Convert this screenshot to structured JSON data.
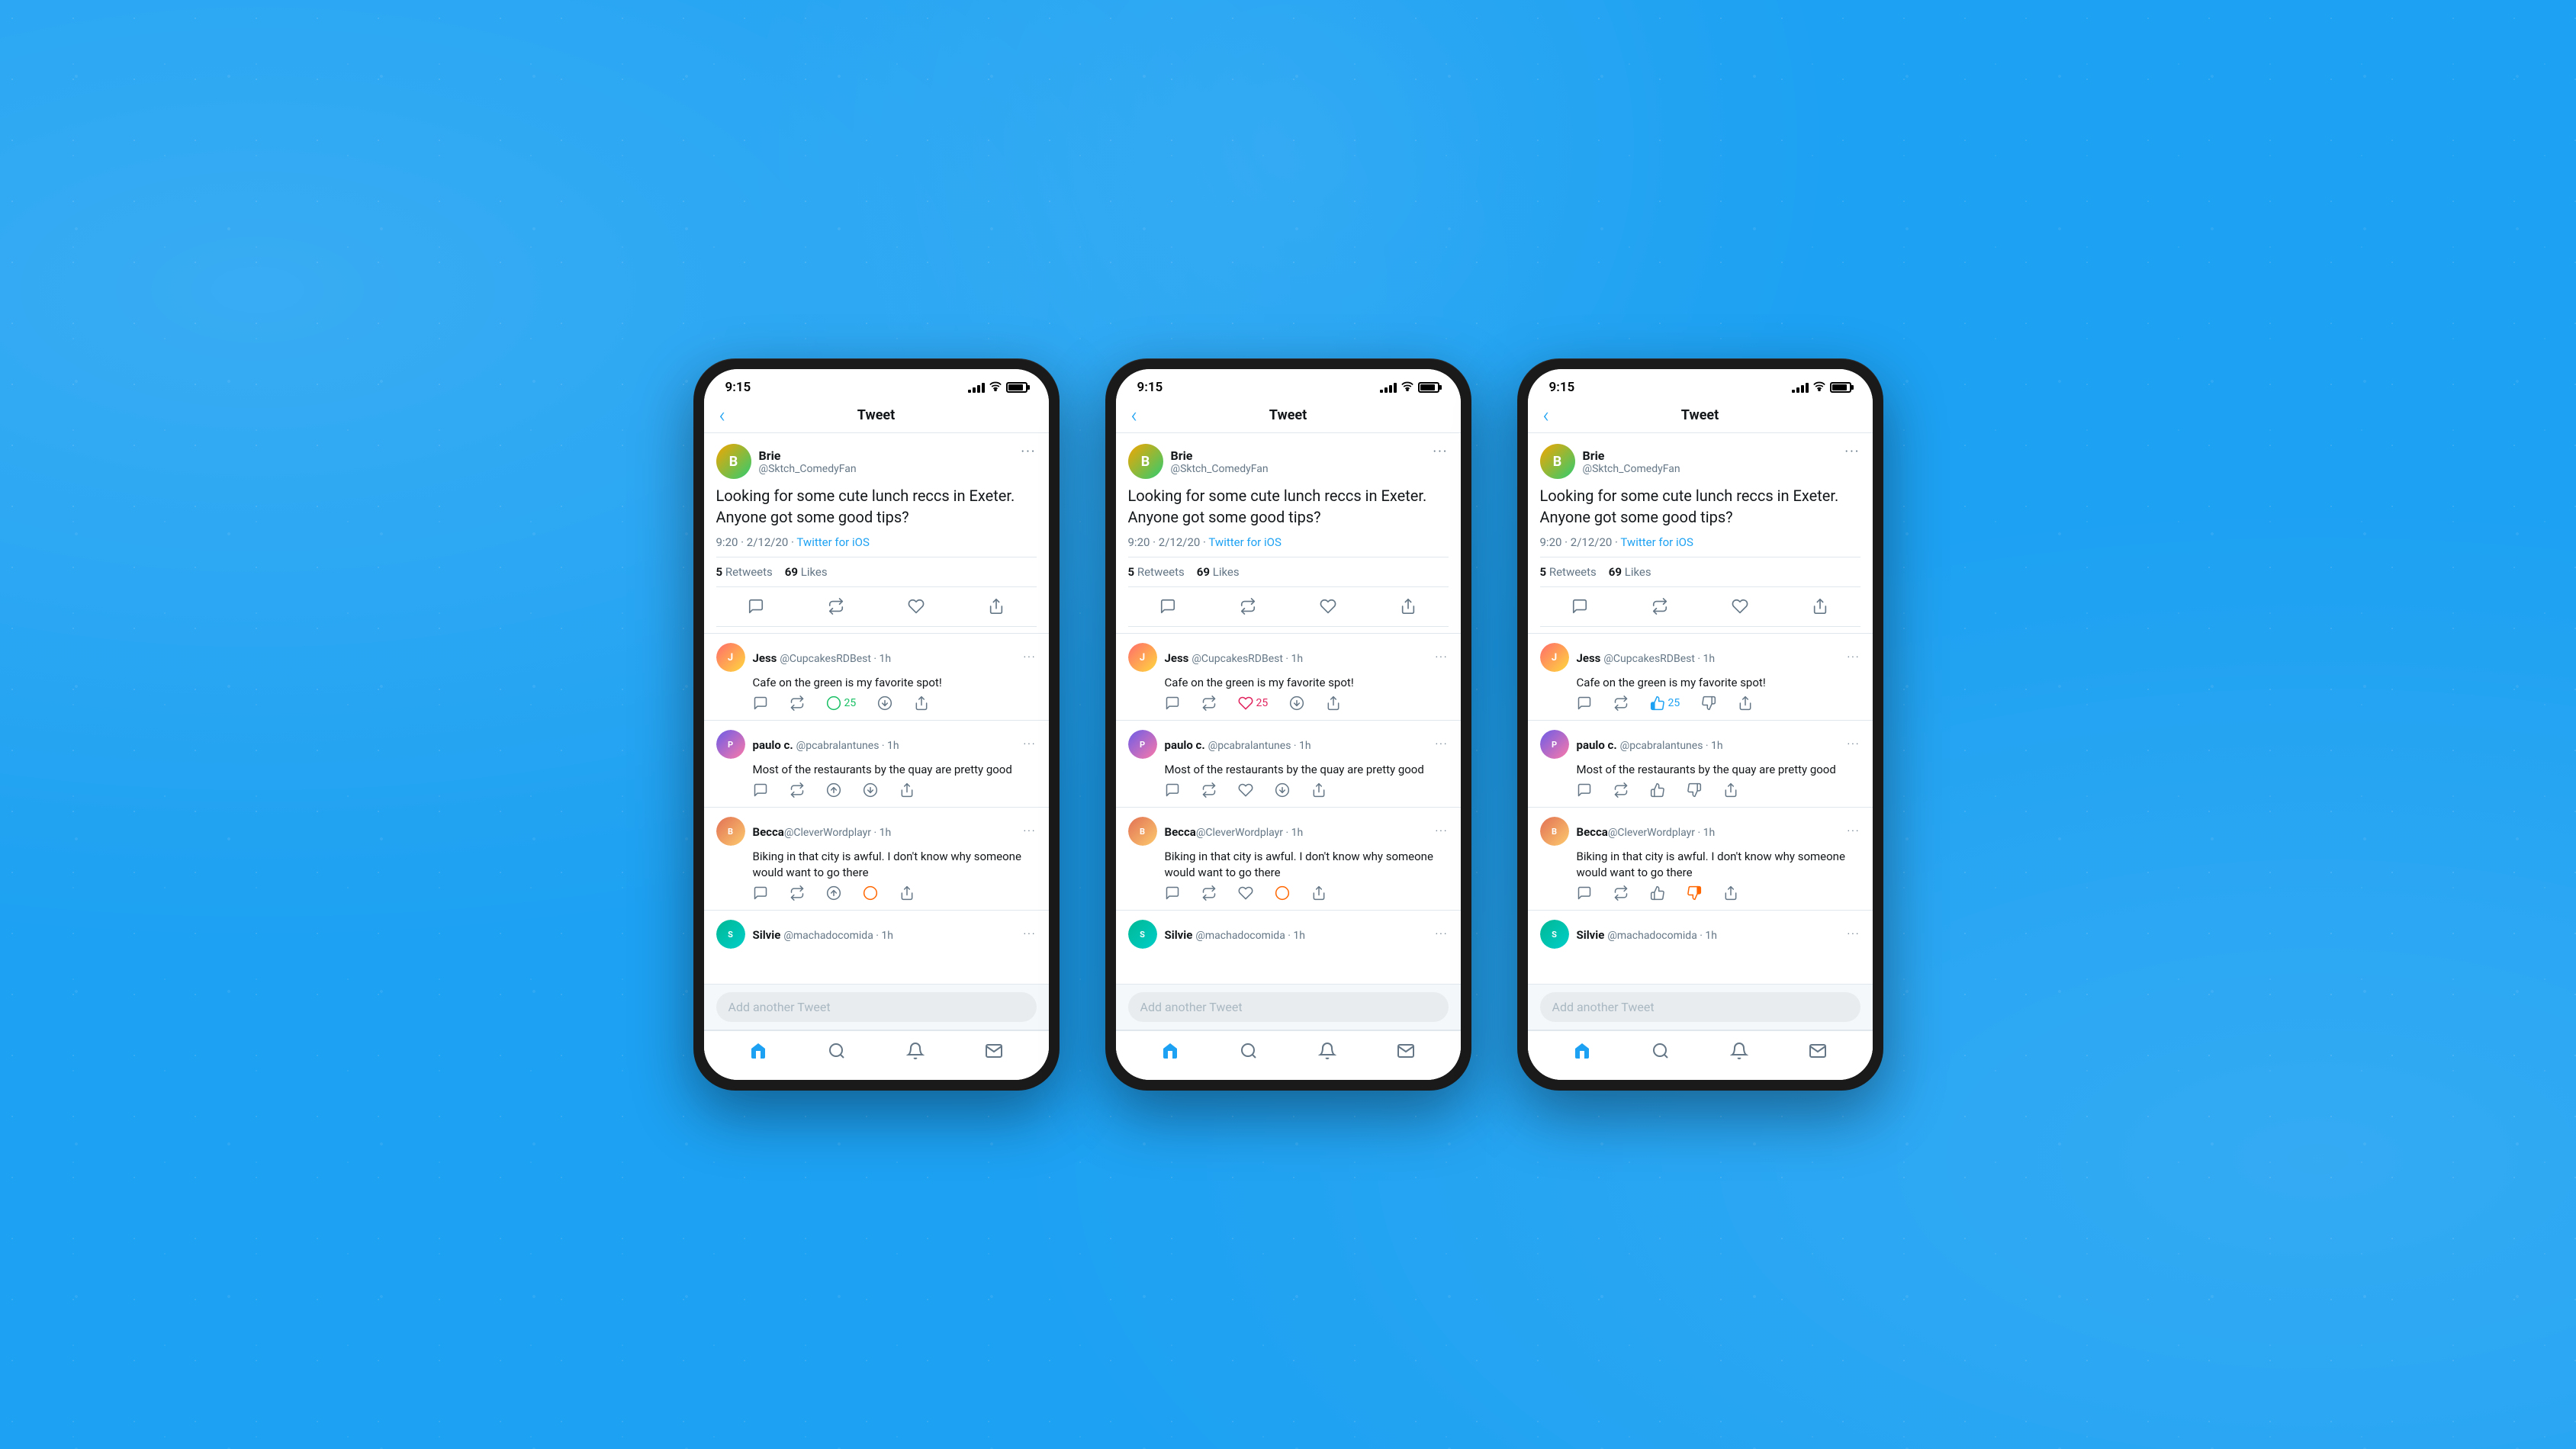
{
  "background_color": "#1da1f2",
  "phones": [
    {
      "id": "phone-1",
      "status_bar": {
        "time": "9:15",
        "signal": true,
        "wifi": true,
        "battery": true
      },
      "nav": {
        "back_label": "‹",
        "title": "Tweet"
      },
      "original_tweet": {
        "user_name": "Brie",
        "user_handle": "@Sktch_ComedyFan",
        "text": "Looking for some cute lunch reccs in Exeter. Anyone got some good tips?",
        "time": "9:20 · 2/12/20",
        "source": "Twitter for iOS",
        "retweets": "5",
        "likes": "69",
        "retweets_label": "Retweets",
        "likes_label": "Likes"
      },
      "replies": [
        {
          "id": "jess",
          "name": "Jess",
          "handle": "@CupcakesRDBest",
          "time": "1h",
          "text": "Cafe on the green is my favorite spot!",
          "vote_style": "upvote_green",
          "vote_count": "25",
          "vote_icon": "▲"
        },
        {
          "id": "paulo",
          "name": "paulo c.",
          "handle": "@pcabralantunes",
          "time": "1h",
          "text": "Most of the restaurants by the quay are pretty good",
          "vote_style": "upvote_outline",
          "vote_count": "",
          "vote_icon": "▲"
        },
        {
          "id": "becca",
          "name": "Becca",
          "handle": "@CleverWordplayr",
          "time": "1h",
          "text": "Biking in that city is awful. I don't know why someone would want to go there",
          "vote_style": "downvote_orange",
          "vote_count": "",
          "vote_icon": "▼"
        },
        {
          "id": "silvie",
          "name": "Silvie",
          "handle": "@machadocomida",
          "time": "1h",
          "text": "",
          "vote_style": "none",
          "vote_count": "",
          "vote_icon": ""
        }
      ],
      "add_tweet_placeholder": "Add another Tweet",
      "bottom_nav": [
        "home",
        "search",
        "notifications",
        "messages"
      ]
    },
    {
      "id": "phone-2",
      "status_bar": {
        "time": "9:15",
        "signal": true,
        "wifi": true,
        "battery": true
      },
      "nav": {
        "back_label": "‹",
        "title": "Tweet"
      },
      "original_tweet": {
        "user_name": "Brie",
        "user_handle": "@Sktch_ComedyFan",
        "text": "Looking for some cute lunch reccs in Exeter. Anyone got some good tips?",
        "time": "9:20 · 2/12/20",
        "source": "Twitter for iOS",
        "retweets": "5",
        "likes": "69",
        "retweets_label": "Retweets",
        "likes_label": "Likes"
      },
      "replies": [
        {
          "id": "jess",
          "name": "Jess",
          "handle": "@CupcakesRDBest",
          "time": "1h",
          "text": "Cafe on the green is my favorite spot!",
          "vote_style": "heart_active",
          "vote_count": "25",
          "vote_icon": "♥"
        },
        {
          "id": "paulo",
          "name": "paulo c.",
          "handle": "@pcabralantunes",
          "time": "1h",
          "text": "Most of the restaurants by the quay are pretty good",
          "vote_style": "none",
          "vote_count": "",
          "vote_icon": ""
        },
        {
          "id": "becca",
          "name": "Becca",
          "handle": "@CleverWordplayr",
          "time": "1h",
          "text": "Biking in that city is awful. I don't know why someone would want to go there",
          "vote_style": "downvote_orange_circle",
          "vote_count": "",
          "vote_icon": "▼"
        },
        {
          "id": "silvie",
          "name": "Silvie",
          "handle": "@machadocomida",
          "time": "1h",
          "text": "",
          "vote_style": "none",
          "vote_count": "",
          "vote_icon": ""
        }
      ],
      "add_tweet_placeholder": "Add another Tweet",
      "bottom_nav": [
        "home",
        "search",
        "notifications",
        "messages"
      ]
    },
    {
      "id": "phone-3",
      "status_bar": {
        "time": "9:15",
        "signal": true,
        "wifi": true,
        "battery": true
      },
      "nav": {
        "back_label": "‹",
        "title": "Tweet"
      },
      "original_tweet": {
        "user_name": "Brie",
        "user_handle": "@Sktch_ComedyFan",
        "text": "Looking for some cute lunch reccs in Exeter. Anyone got some good tips?",
        "time": "9:20 · 2/12/20",
        "source": "Twitter for iOS",
        "retweets": "5",
        "likes": "69",
        "retweets_label": "Retweets",
        "likes_label": "Likes"
      },
      "replies": [
        {
          "id": "jess",
          "name": "Jess",
          "handle": "@CupcakesRDBest",
          "time": "1h",
          "text": "Cafe on the green is my favorite spot!",
          "vote_style": "thumbup_active",
          "vote_count": "25",
          "vote_icon": "👍"
        },
        {
          "id": "paulo",
          "name": "paulo c.",
          "handle": "@pcabralantunes",
          "time": "1h",
          "text": "Most of the restaurants by the quay are pretty good",
          "vote_style": "none",
          "vote_count": "",
          "vote_icon": ""
        },
        {
          "id": "becca",
          "name": "Becca",
          "handle": "@CleverWordplayr",
          "time": "1h",
          "text": "Biking in that city is awful. I don't know why someone would want to go there",
          "vote_style": "thumbdown_orange",
          "vote_count": "",
          "vote_icon": "👎"
        },
        {
          "id": "silvie",
          "name": "Silvie",
          "handle": "@machadocomida",
          "time": "1h",
          "text": "",
          "vote_style": "none",
          "vote_count": "",
          "vote_icon": ""
        }
      ],
      "add_tweet_placeholder": "Add another Tweet",
      "bottom_nav": [
        "home",
        "search",
        "notifications",
        "messages"
      ]
    }
  ]
}
